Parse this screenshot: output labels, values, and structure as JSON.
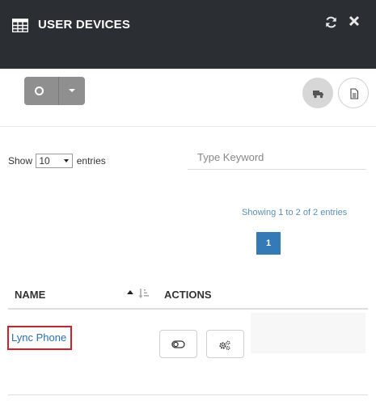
{
  "header": {
    "title": "USER DEVICES",
    "icon": "table-icon",
    "actions": [
      "refresh-icon",
      "close-icon"
    ]
  },
  "toolbar": {
    "split_button": {
      "icon": "circle-icon",
      "caret": "caret-down-icon"
    },
    "right_buttons": [
      "truck-icon",
      "document-icon"
    ]
  },
  "length": {
    "prefix": "Show",
    "value": "10",
    "suffix": "entries"
  },
  "search": {
    "placeholder": "Type Keyword",
    "value": ""
  },
  "info": "Showing 1 to 2 of 2 entries",
  "pagination": {
    "current": "1"
  },
  "table": {
    "columns": [
      "NAME",
      "ACTIONS"
    ],
    "rows": [
      {
        "name": "Lync Phone",
        "actions": [
          "toggle-icon",
          "cogs-icon"
        ]
      }
    ]
  },
  "colors": {
    "header_bg": "#2b2e33",
    "accent": "#337ab7",
    "link": "#2a6fb0",
    "highlight": "#d0202a"
  }
}
